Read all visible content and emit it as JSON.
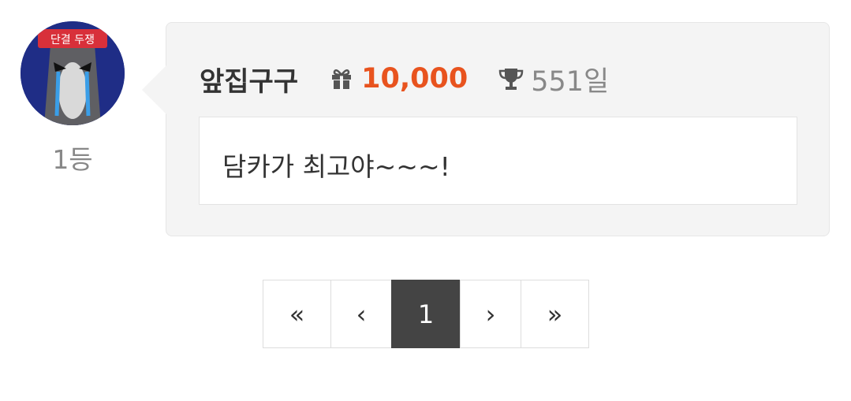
{
  "comment": {
    "rank_label": "1등",
    "avatar_text": "단결 두쟁",
    "user_name": "앞집구구",
    "gift_icon": "gift-icon",
    "points": "10,000",
    "trophy_icon": "trophy-icon",
    "days": "551일",
    "message": "담카가 최고야~~~!",
    "colors": {
      "points": "#e8531e",
      "card_bg": "#f4f4f4",
      "avatar_bg": "#1f2d86"
    }
  },
  "pagination": {
    "first_label": "«",
    "prev_label": "‹",
    "current_page": "1",
    "next_label": "›",
    "last_label": "»",
    "active_color": "#444444"
  }
}
